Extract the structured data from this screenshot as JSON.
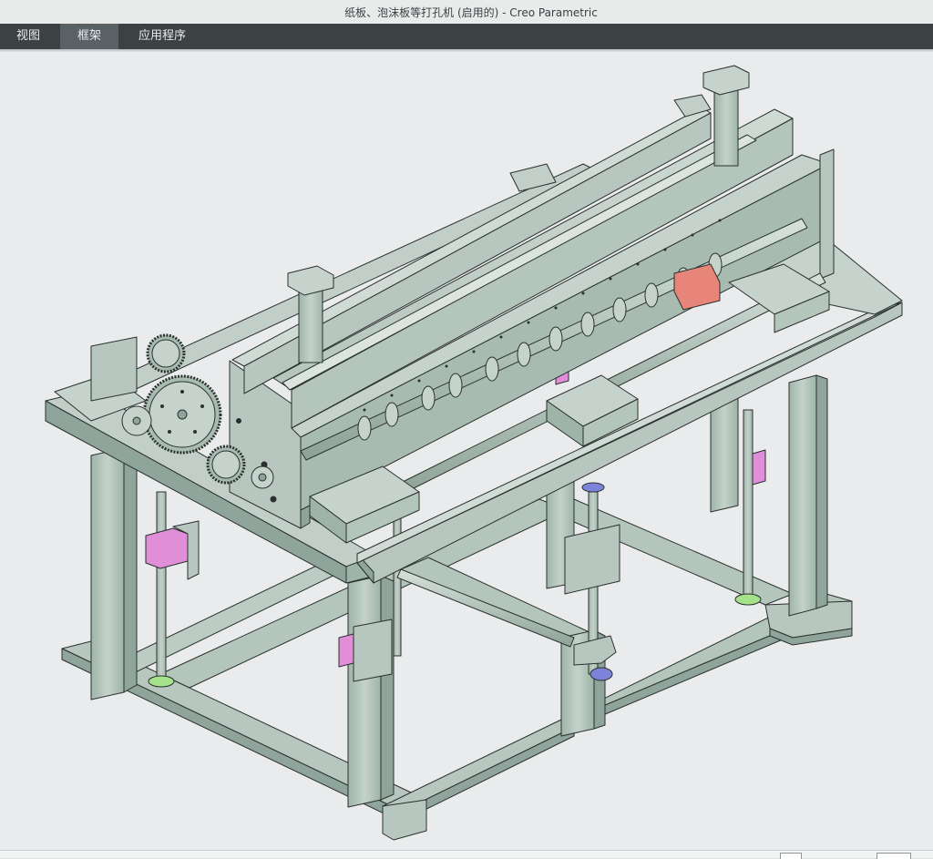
{
  "window": {
    "title": "纸板、泡沫板等打孔机 (启用的) - Creo Parametric"
  },
  "menu": {
    "items": [
      {
        "label": "视图",
        "active": false
      },
      {
        "label": "框架",
        "active": true
      },
      {
        "label": "应用程序",
        "active": false
      }
    ]
  },
  "viewport": {
    "model_name": "纸板、泡沫板等打孔机",
    "colors": {
      "metal": "#b7c7bf",
      "metal_dark": "#8fa59b",
      "metal_light": "#d3ded8",
      "edge": "#2a302e",
      "bearing_pink": "#e08ed8",
      "nut_green": "#a6e28a",
      "block_red": "#e8857a",
      "flange_blue": "#7d83d8",
      "background": "#e9ebec"
    }
  },
  "status": {
    "widgets": [
      "status-left-widget",
      "status-right-widget"
    ]
  }
}
